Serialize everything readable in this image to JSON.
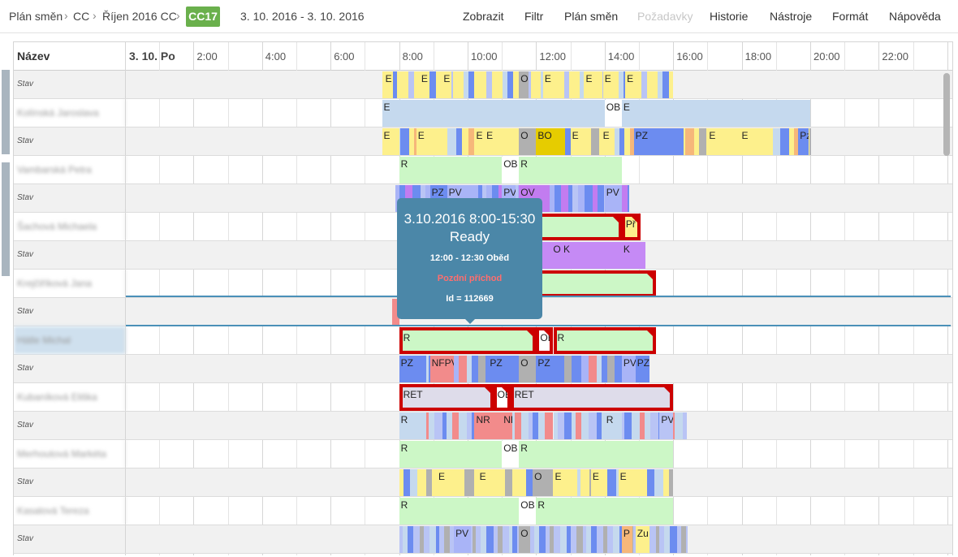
{
  "breadcrumb": {
    "items": [
      "Plán směn",
      "CC",
      "Říjen 2016 CC"
    ],
    "current": "CC17",
    "badge_color": "#6ab04c"
  },
  "date_range": "3. 10. 2016 - 3. 10. 2016",
  "menu": [
    "Zobrazit",
    "Filtr",
    "Plán směn",
    "Požadavky",
    "Historie",
    "Nástroje",
    "Formát",
    "Nápověda"
  ],
  "menu_disabled": [
    "Požadavky"
  ],
  "grid": {
    "name_header": "Název",
    "date_header": "3. 10. Po",
    "hours": [
      "2:00",
      "4:00",
      "6:00",
      "8:00",
      "10:00",
      "12:00",
      "14:00",
      "16:00",
      "18:00",
      "20:00",
      "22:00"
    ],
    "rows": [
      {
        "type": "stav",
        "label": "Stav"
      },
      {
        "type": "person",
        "label": "Kolínská Jaroslava"
      },
      {
        "type": "stav",
        "label": "Stav"
      },
      {
        "type": "person",
        "label": "Vambarská Petra"
      },
      {
        "type": "stav",
        "label": "Stav"
      },
      {
        "type": "person",
        "label": "Šachová Michaela"
      },
      {
        "type": "stav",
        "label": "Stav"
      },
      {
        "type": "person",
        "label": "Krejčiříková Jana"
      },
      {
        "type": "stav",
        "label": "Stav"
      },
      {
        "type": "person",
        "label": "Hátle Michal"
      },
      {
        "type": "stav",
        "label": "Stav"
      },
      {
        "type": "person",
        "label": "Kubaníková Eliška"
      },
      {
        "type": "stav",
        "label": "Stav"
      },
      {
        "type": "person",
        "label": "Merhoutová Markéta"
      },
      {
        "type": "stav",
        "label": "Stav"
      },
      {
        "type": "person",
        "label": "Kasalová Tereza"
      },
      {
        "type": "stav",
        "label": "Stav"
      }
    ]
  },
  "colors": {
    "E": "#fdf08c",
    "R": "#ccf7c6",
    "OB": "#ffffff",
    "O": "#b0b0b0",
    "BO": "#e6cc00",
    "PZ": "#6c8cf0",
    "PV": "#a9b4f7",
    "OV": "#c27cf0",
    "K": "#c58af5",
    "NR": "#f28b8b",
    "RET": "#dedcea",
    "light": "#c5d9ee",
    "blue": "#6c8cf0",
    "gray": "#b0b0b0",
    "orange": "#f6b77a",
    "green": "#8cea7c",
    "red": "#c00000",
    "lav": "#b9c4f5"
  },
  "tooltip": {
    "title": "3.10.2016 8:00-15:30",
    "status": "Ready",
    "break": "12:00 - 12:30 Oběd",
    "late": "Pozdní příchod",
    "id": "Id = 112669"
  }
}
